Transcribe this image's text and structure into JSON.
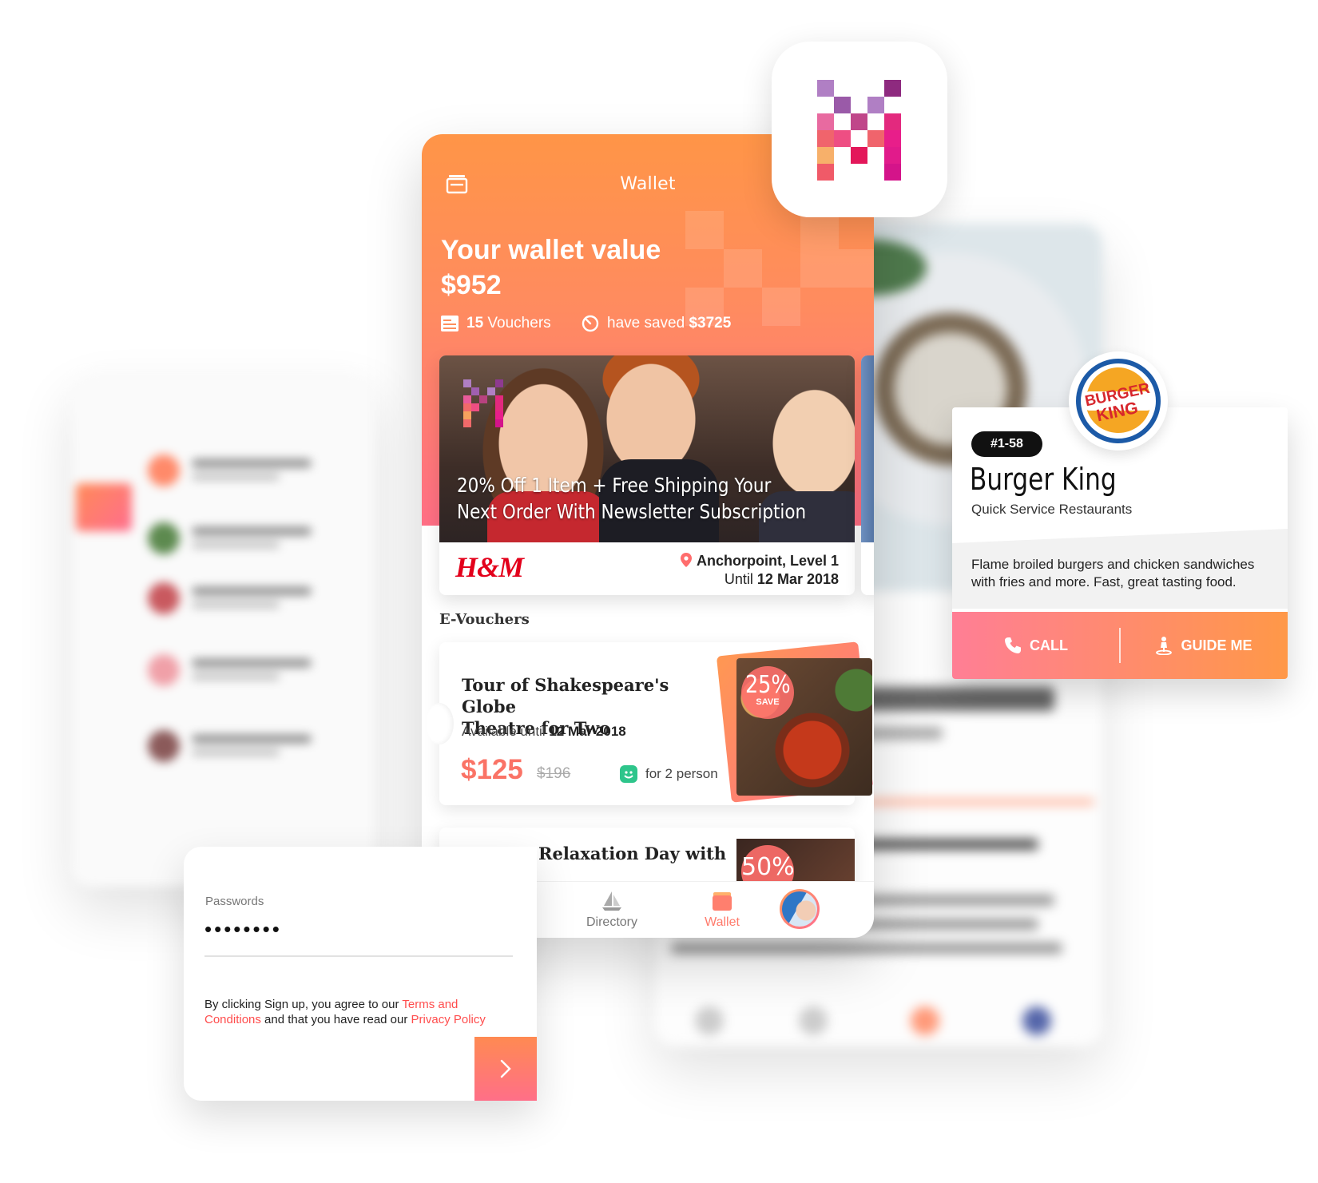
{
  "wallet_screen": {
    "title": "Wallet",
    "value_label": "Your wallet value",
    "value_amount": "$952",
    "vouchers_count": "15",
    "vouchers_label": "Vouchers",
    "saved_label": "have saved",
    "saved_amount": "$3725",
    "promo": {
      "headline_line1": "20% Off 1 Item + Free Shipping Your",
      "headline_line2": "Next Order With Newsletter Subscription",
      "brand": "H&M",
      "location": "Anchorpoint, Level 1",
      "until_label": "Until",
      "until_date": "12 Mar 2018"
    },
    "section_title": "E-Vouchers",
    "vouchers": [
      {
        "title_line1": "Tour of Shakespeare's Globe",
        "title_line2": "Theatre for Two",
        "available_label": "Available until",
        "available_date": "12 Mar 2018",
        "price": "$125",
        "old_price": "$196",
        "persons": "for 2 person",
        "discount": "25%",
        "discount_label": "SAVE"
      },
      {
        "title_fragment": "Relaxation Day with",
        "discount": "50%"
      }
    ],
    "tabs": [
      {
        "label": "Directory",
        "icon": "sailboat-icon"
      },
      {
        "label": "Wallet",
        "icon": "wallet-icon",
        "active": true
      }
    ]
  },
  "business_card": {
    "unit": "#1-58",
    "name": "Burger King",
    "category": "Quick Service Restaurants",
    "description": "Flame broiled burgers and chicken sandwiches with fries and more. Fast, great tasting food.",
    "call_label": "CALL",
    "guide_label": "GUIDE ME",
    "logo_text_top": "BURGER",
    "logo_text_bottom": "KING"
  },
  "signup_card": {
    "password_label": "Passwords",
    "password_value": "••••••••",
    "terms_prefix": "By clicking Sign up, you agree to our ",
    "terms_link": "Terms and Conditions",
    "terms_middle": " and that you have read our ",
    "privacy_link": "Privacy Policy"
  },
  "colors": {
    "accent_orange": "#ff9547",
    "accent_pink": "#ff6e85",
    "price_red": "#fa7366",
    "link_red": "#ff4d4d",
    "hm_red": "#e3001b"
  }
}
